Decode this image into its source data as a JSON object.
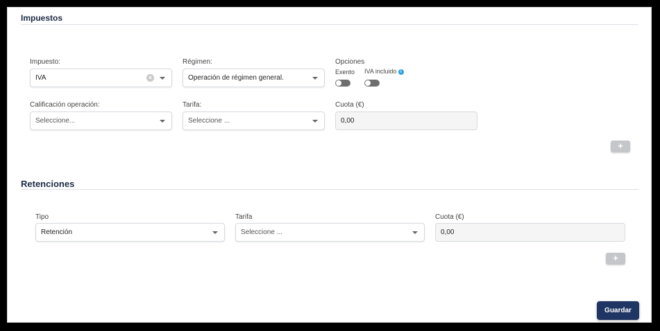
{
  "impuestos": {
    "title": "Impuestos",
    "impuesto_label": "Impuesto:",
    "impuesto_value": "IVA",
    "regimen_label": "Régimen:",
    "regimen_value": "Operación de régimen general.",
    "opciones_label": "Opciones",
    "exento_label": "Exento",
    "iva_incluido_label": "IVA incluido",
    "calificacion_label": "Calificación operación:",
    "calificacion_placeholder": "Seleccione...",
    "tarifa_label": "Tarifa:",
    "tarifa_placeholder": "Seleccione ...",
    "cuota_label": "Cuota (€)",
    "cuota_value": "0,00",
    "add_label": "+"
  },
  "retenciones": {
    "title": "Retenciones",
    "tipo_label": "Tipo",
    "tipo_value": "Retención",
    "tarifa_label": "Tarifa",
    "tarifa_placeholder": "Seleccione ...",
    "cuota_label": "Cuota (€)",
    "cuota_value": "0,00",
    "add_label": "+"
  },
  "footer": {
    "save_label": "Guardar"
  },
  "colors": {
    "accent": "#1f3563",
    "info": "#29a3dc"
  }
}
